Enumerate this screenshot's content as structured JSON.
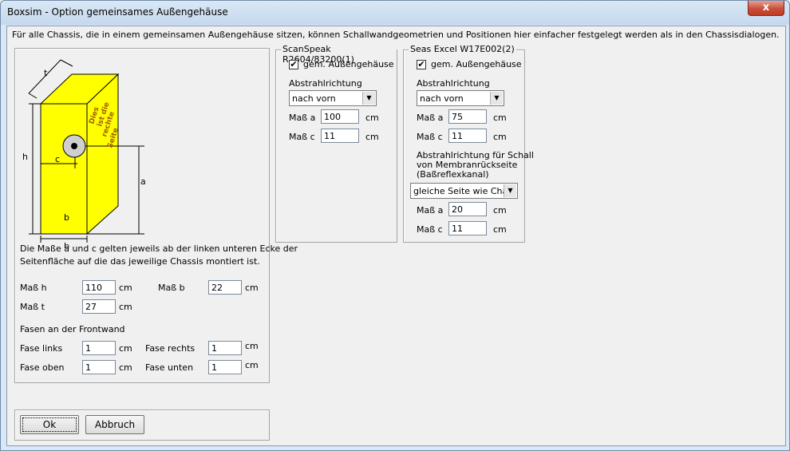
{
  "window": {
    "title": "Boxsim - Option gemeinsames Außengehäuse",
    "close_glyph": "x"
  },
  "intro": "Für alle Chassis, die in einem gemeinsamen Außengehäuse sitzen, können Schallwandgeometrien und Positionen hier einfacher festgelegt werden als in den Chassisdialogen.",
  "diagram": {
    "label_t": "t",
    "label_h": "h",
    "label_c": "c",
    "label_a": "a",
    "label_b": "b",
    "side_text": [
      "Dies",
      "ist die",
      "rechte",
      "Seite"
    ]
  },
  "note": [
    "Die Maße a und c gelten jeweils ab der linken unteren Ecke der",
    "Seitenfläche auf die das jeweilige Chassis montiert ist."
  ],
  "dims": {
    "h_label": "Maß h",
    "h_value": "110",
    "h_unit": "cm",
    "b_label": "Maß b",
    "b_value": "22",
    "b_unit": "cm",
    "t_label": "Maß t",
    "t_value": "27",
    "t_unit": "cm"
  },
  "fasen": {
    "heading": "Fasen an der Frontwand",
    "links_label": "Fase links",
    "links_value": "1",
    "links_unit": "cm",
    "rechts_label": "Fase rechts",
    "rechts_value": "1",
    "rechts_unit": "cm",
    "oben_label": "Fase oben",
    "oben_value": "1",
    "oben_unit": "cm",
    "unten_label": "Fase unten",
    "unten_value": "1",
    "unten_unit": "cm"
  },
  "chassis1": {
    "title": "ScanSpeak R2604/83200(1)",
    "checkbox_label": "gem. Außengehäuse",
    "checked": "✔",
    "abstrahl_label": "Abstrahlrichtung",
    "abstrahl_value": "nach vorn",
    "a_label": "Maß a",
    "a_value": "100",
    "a_unit": "cm",
    "c_label": "Maß c",
    "c_value": "11",
    "c_unit": "cm"
  },
  "chassis2": {
    "title": "Seas Excel W17E002(2)",
    "checkbox_label": "gem. Außengehäuse",
    "checked": "✔",
    "abstrahl_label": "Abstrahlrichtung",
    "abstrahl_value": "nach vorn",
    "a_label": "Maß a",
    "a_value": "75",
    "a_unit": "cm",
    "c_label": "Maß c",
    "c_value": "11",
    "c_unit": "cm",
    "rear_label": [
      "Abstrahlrichtung für Schall",
      "von Membranrückseite",
      "(Baßreflexkanal)"
    ],
    "rear_value": "gleiche Seite wie Chass",
    "a2_label": "Maß a",
    "a2_value": "20",
    "a2_unit": "cm",
    "c2_label": "Maß c",
    "c2_value": "11",
    "c2_unit": "cm"
  },
  "buttons": {
    "ok": "Ok",
    "cancel": "Abbruch"
  },
  "colors": {
    "box_yellow": "#ffff00",
    "title_bg": "#c4d8ee",
    "close_red": "#c8503a"
  }
}
